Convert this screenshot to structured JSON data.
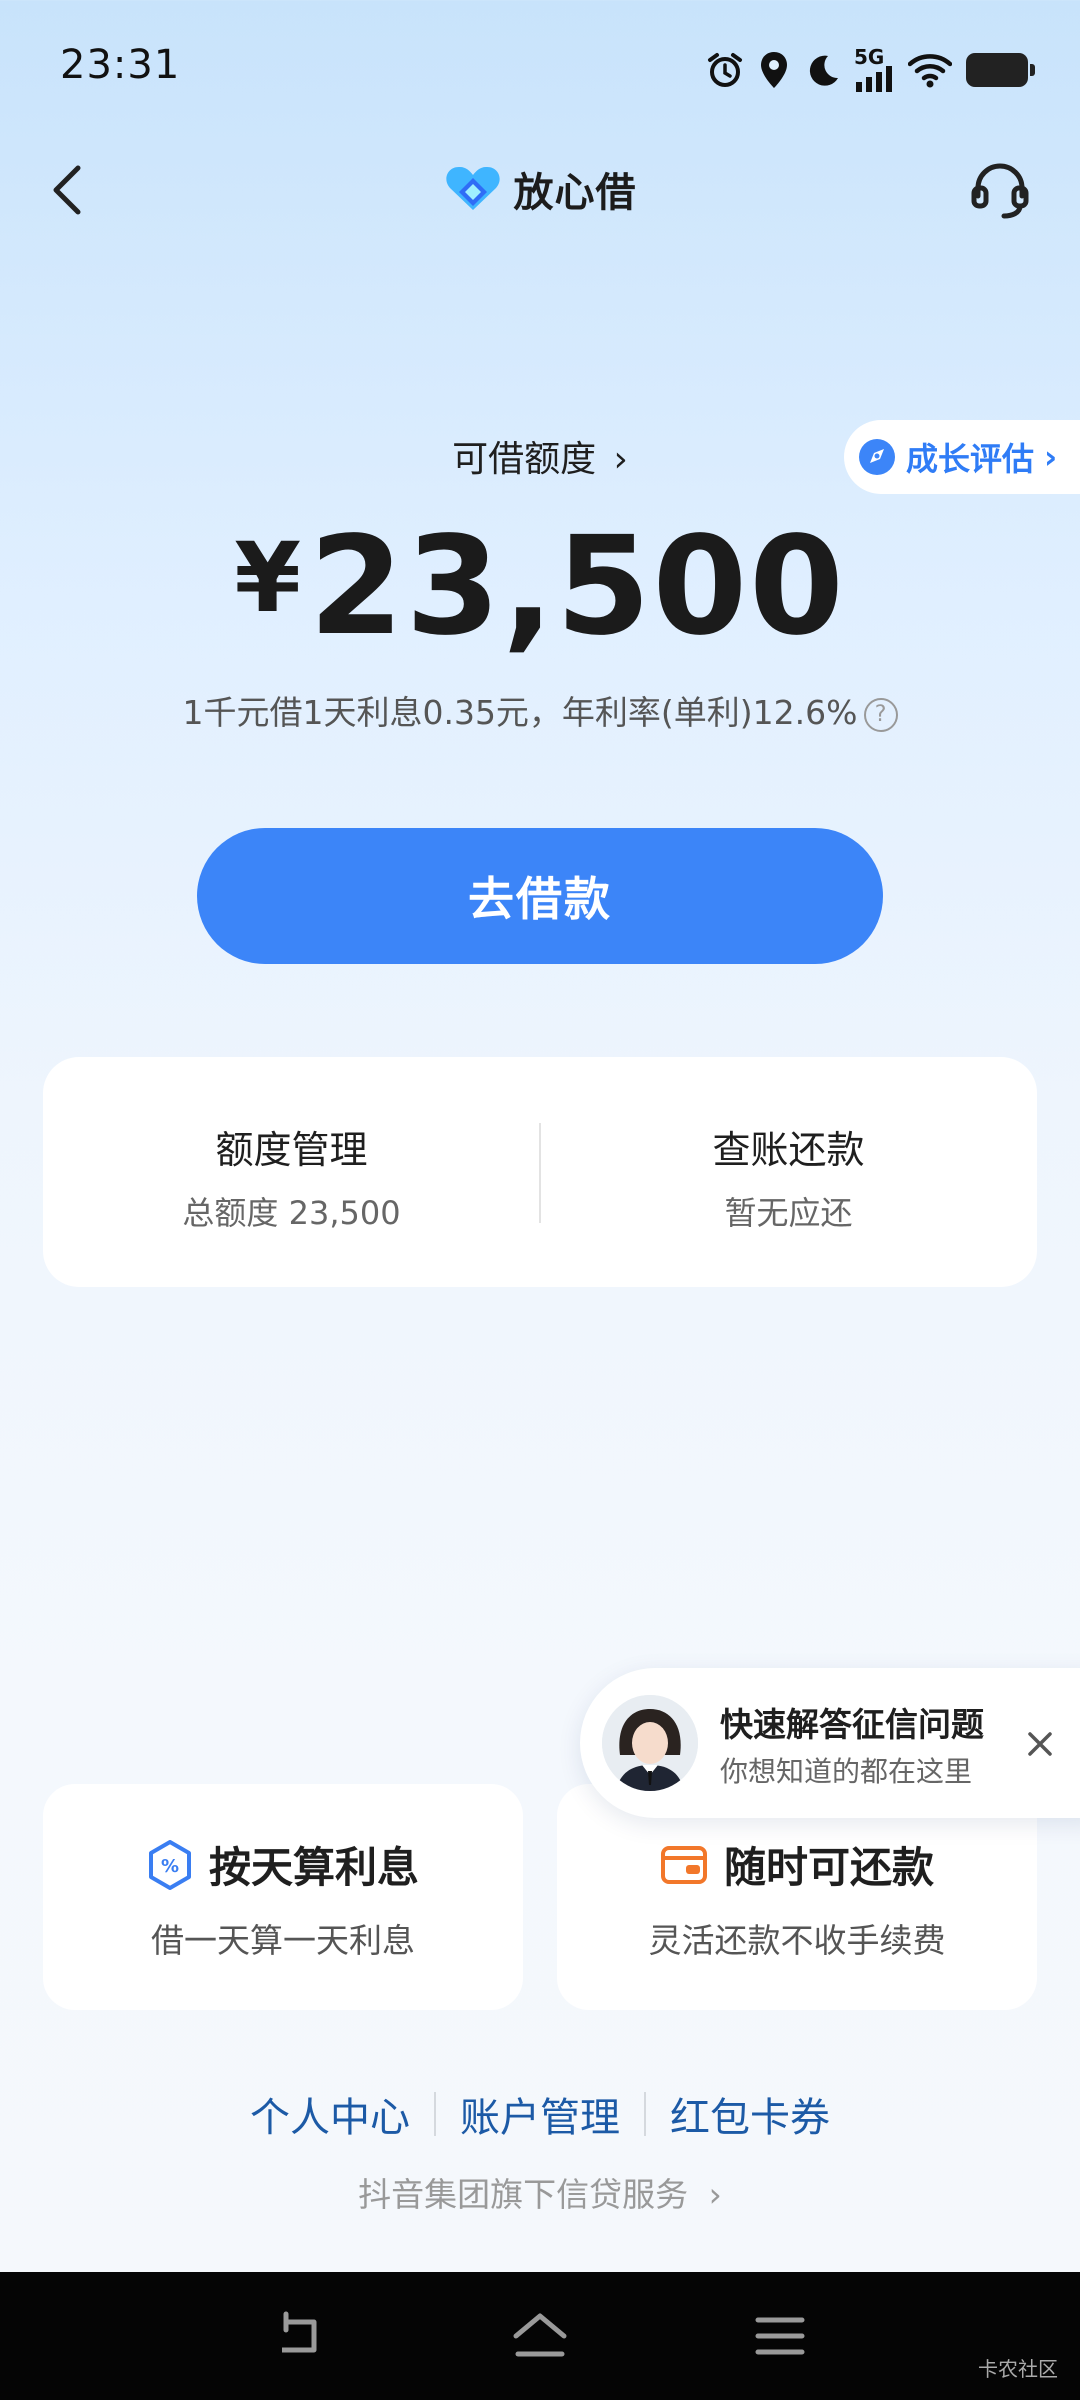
{
  "status_bar": {
    "time": "23:31",
    "network": "5G",
    "icons": [
      "alarm-icon",
      "location-icon",
      "moon-icon",
      "signal-icon",
      "wifi-icon",
      "battery-icon"
    ]
  },
  "header": {
    "brand_name": "放心借",
    "icons": [
      "back-arrow-icon",
      "brand-logo-icon",
      "headset-icon"
    ]
  },
  "credit": {
    "label": "可借额度",
    "chevron": "›",
    "currency_symbol": "¥",
    "amount": "23,500",
    "rate_text": "1千元借1天利息0.35元，年利率(单利)12.6%",
    "help_glyph": "?"
  },
  "growth_pill": {
    "label": "成长评估",
    "chevron": "›"
  },
  "borrow_button": {
    "label": "去借款"
  },
  "management_card": {
    "limit": {
      "title": "额度管理",
      "sub": "总额度 23,500"
    },
    "repay": {
      "title": "查账还款",
      "sub": "暂无应还"
    }
  },
  "toast": {
    "title": "快速解答征信问题",
    "sub": "你想知道的都在这里"
  },
  "features": [
    {
      "title": "按天算利息",
      "sub": "借一天算一天利息",
      "icon": "percent-shield-icon",
      "color": "#3a7ef2"
    },
    {
      "title": "随时可还款",
      "sub": "灵活还款不收手续费",
      "icon": "wallet-icon",
      "color": "#f2772a"
    }
  ],
  "footer": {
    "links": [
      "个人中心",
      "账户管理",
      "红包卡券"
    ],
    "note": "抖音集团旗下信贷服务",
    "note_chevron": "›"
  },
  "navbar": {
    "icons": [
      "nav-back-icon",
      "nav-home-icon",
      "nav-menu-icon"
    ],
    "watermark": "卡农社区"
  },
  "colors": {
    "accent": "#3c85f8",
    "link": "#1c5aa6",
    "growth": "#2f7cf6"
  }
}
